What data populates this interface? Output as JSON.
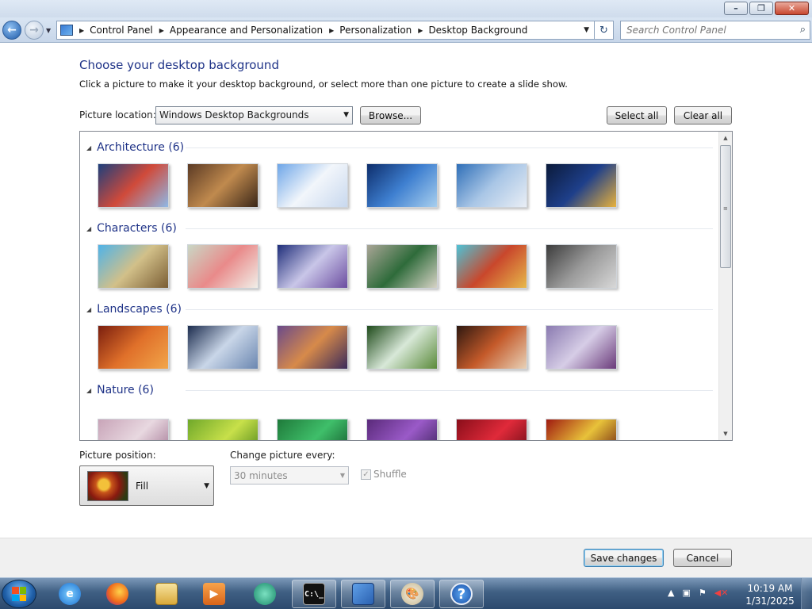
{
  "breadcrumb": [
    "Control Panel",
    "Appearance and Personalization",
    "Personalization",
    "Desktop Background"
  ],
  "search": {
    "placeholder": "Search Control Panel"
  },
  "heading": "Choose your desktop background",
  "subtext": "Click a picture to make it your desktop background, or select more than one picture to create a slide show.",
  "picture_location": {
    "label": "Picture location:",
    "value": "Windows Desktop Backgrounds"
  },
  "buttons": {
    "browse": "Browse...",
    "select_all": "Select all",
    "clear_all": "Clear all",
    "save": "Save changes",
    "cancel": "Cancel"
  },
  "groups": [
    {
      "title": "Architecture (6)",
      "colors": [
        [
          "#1d3f7c",
          "#d04a3a",
          "#8fb8e6"
        ],
        [
          "#5b3a24",
          "#c08a4e",
          "#3a2618"
        ],
        [
          "#6ea6e8",
          "#f2f6fb",
          "#c8d8ee"
        ],
        [
          "#0d2d6b",
          "#3e7fd0",
          "#a8cfee"
        ],
        [
          "#2f6fb8",
          "#a9c6e6",
          "#e9eef5"
        ],
        [
          "#0b1a3a",
          "#1e3f8a",
          "#e8b23c"
        ]
      ]
    },
    {
      "title": "Characters (6)",
      "colors": [
        [
          "#4fb3e8",
          "#d2c089",
          "#7a5d34"
        ],
        [
          "#c9d7c5",
          "#e98a8a",
          "#f1efe8"
        ],
        [
          "#1f2e7a",
          "#c9c6e8",
          "#6b4da0"
        ],
        [
          "#a9a596",
          "#2e6b3a",
          "#d7d3c6"
        ],
        [
          "#4ec2d6",
          "#c9472c",
          "#e7b94a"
        ],
        [
          "#3c3c3c",
          "#9a9a9a",
          "#d8d8d8"
        ]
      ]
    },
    {
      "title": "Landscapes (6)",
      "colors": [
        [
          "#7a1e0e",
          "#e0702a",
          "#f2a64a"
        ],
        [
          "#1c2c4e",
          "#c9d6e8",
          "#6a86b0"
        ],
        [
          "#6a4a8a",
          "#d78a4a",
          "#3a2a5a"
        ],
        [
          "#1e4a1a",
          "#d8e8d8",
          "#5a8a3a"
        ],
        [
          "#2e1810",
          "#c45a2a",
          "#e8d2b8"
        ],
        [
          "#8a7ab0",
          "#d6cde6",
          "#6a3a7a"
        ]
      ]
    },
    {
      "title": "Nature (6)",
      "colors": [
        [
          "#c8a4b8",
          "#e8d8e0",
          "#9a6a8a"
        ],
        [
          "#6fa82a",
          "#c8e04a",
          "#3e7a12"
        ],
        [
          "#1f7a3a",
          "#3fbf6a",
          "#0e4a22"
        ],
        [
          "#5a2a7a",
          "#9a5ac8",
          "#2e1a4a"
        ],
        [
          "#8a0e1a",
          "#e02a3a",
          "#5a0810"
        ],
        [
          "#a01a10",
          "#e8c23a",
          "#5a0a08"
        ]
      ]
    }
  ],
  "picture_position": {
    "label": "Picture position:",
    "value": "Fill"
  },
  "change_every": {
    "label": "Change picture every:",
    "value": "30 minutes"
  },
  "shuffle": {
    "label": "Shuffle",
    "checked": true
  },
  "clock": {
    "time": "10:19 AM",
    "date": "1/31/2025"
  },
  "taskbar_items": [
    "internet-explorer",
    "firefox",
    "file-explorer",
    "media-player",
    "app-green",
    "command-prompt",
    "control-panel",
    "paint",
    "help"
  ]
}
